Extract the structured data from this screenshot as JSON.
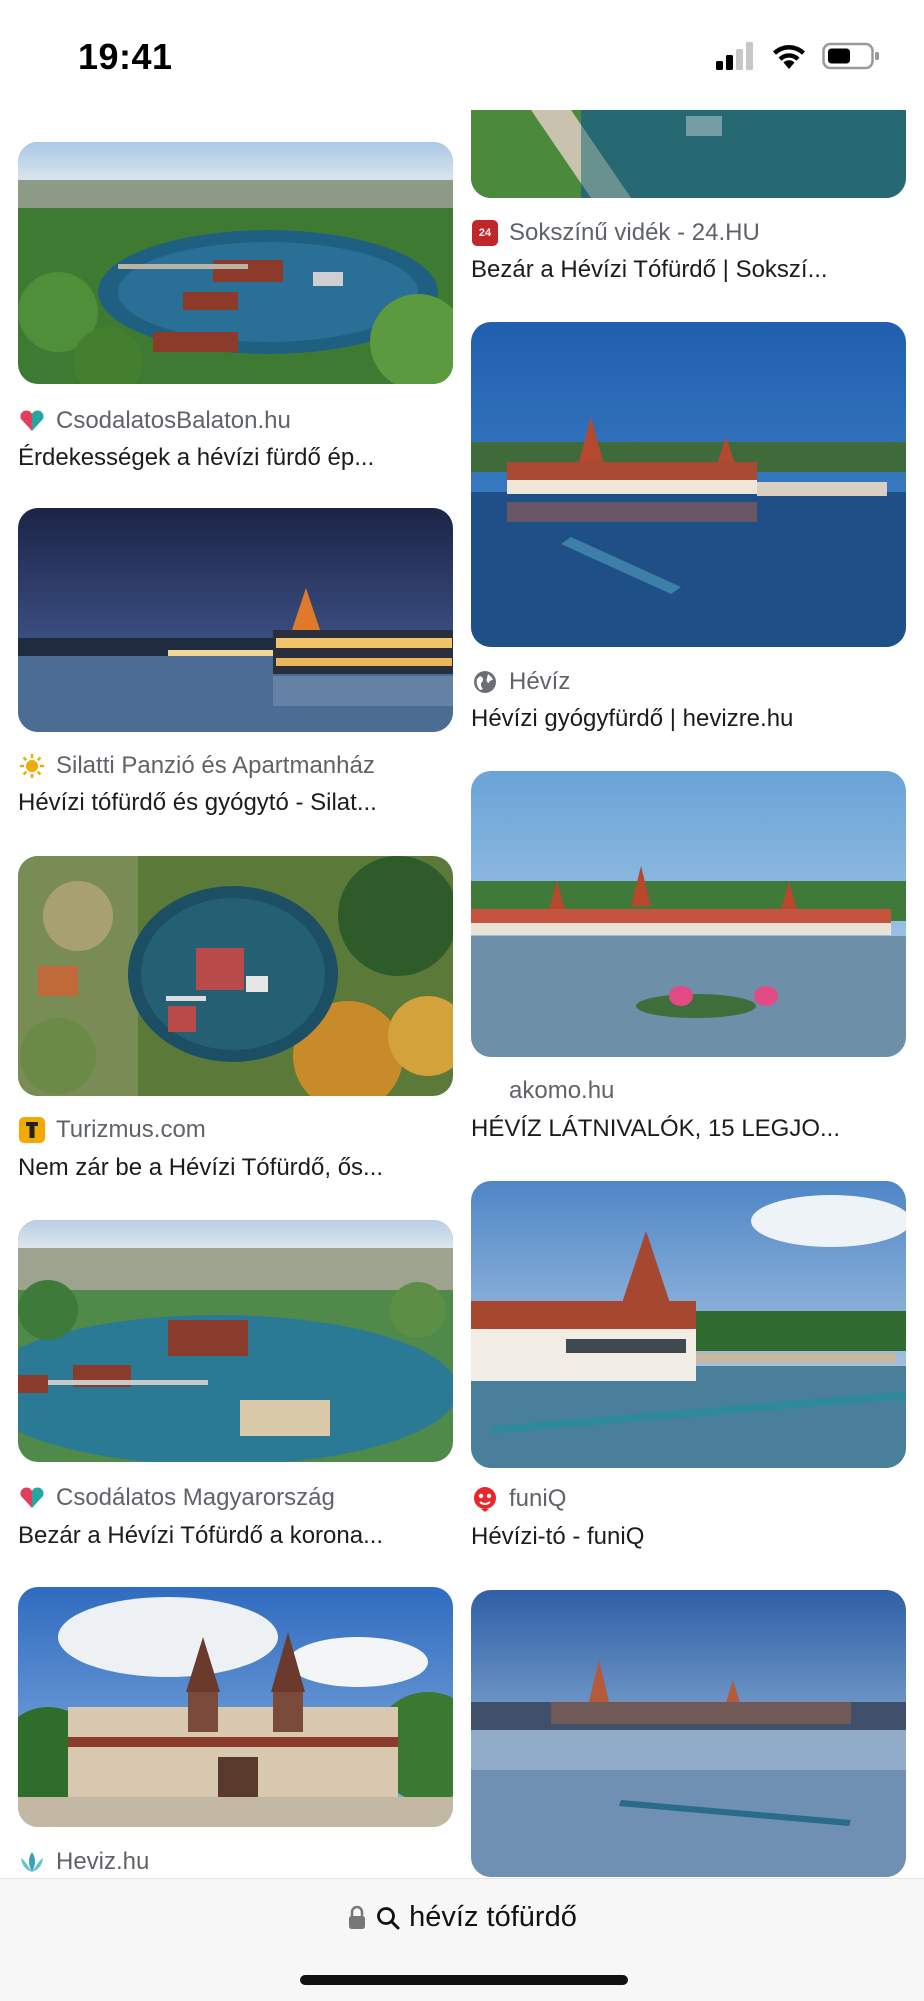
{
  "status_bar": {
    "time": "19:41"
  },
  "results": {
    "left": [
      {
        "source": "CsodalatosBalaton.hu",
        "title": "Érdekességek a hévízi fürdő ép...",
        "favicon": "heart-icon"
      },
      {
        "source": "Silatti Panzió és Apartmanház",
        "title": "Hévízi tófürdő és gyógytó - Silat...",
        "favicon": "sun-icon"
      },
      {
        "source": "Turizmus.com",
        "title": "Nem zár be a Hévízi Tófürdő, ős...",
        "favicon": "t-logo-icon"
      },
      {
        "source": "Csodálatos Magyarország",
        "title": "Bezár a Hévízi Tófürdő a korona...",
        "favicon": "heart-icon"
      },
      {
        "source": "Heviz.hu",
        "title": "",
        "favicon": "lotus-icon"
      }
    ],
    "right": [
      {
        "source": "Sokszínű vidék - 24.HU",
        "title": "Bezár a Hévízi Tófürdő | Sokszí...",
        "favicon": "24hu-logo-icon",
        "favicon_text": "24"
      },
      {
        "source": "Hévíz",
        "title": "Hévízi gyógyfürdő | hevizre.hu",
        "favicon": "globe-icon"
      },
      {
        "source": "akomo.hu",
        "title": "HÉVÍZ LÁTNIVALÓK, 15 LEGJO...",
        "favicon": ""
      },
      {
        "source": "funiQ",
        "title": "Hévízi-tó - funiQ",
        "favicon": "red-face-icon"
      }
    ]
  },
  "address_bar": {
    "query": "hévíz tófürdő"
  },
  "colors": {
    "accent_red": "#e8262b",
    "turizmus_yellow": "#f2a900",
    "csodalatos_pink": "#e0405e",
    "csodalatos_teal": "#25a7a0"
  }
}
